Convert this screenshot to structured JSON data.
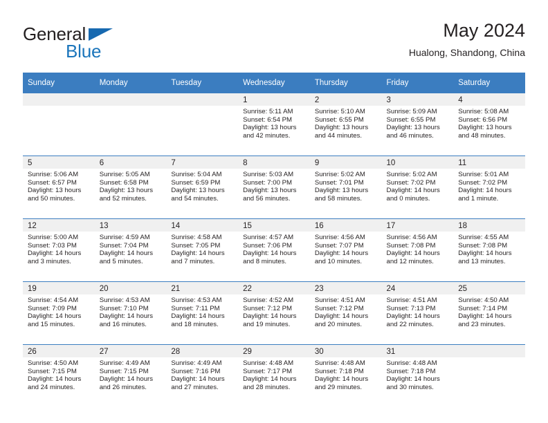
{
  "brand": {
    "name_part1": "General",
    "name_part2": "Blue",
    "triangle_color": "#1769b0",
    "blue_color": "#1b75bb"
  },
  "header": {
    "title": "May 2024",
    "subtitle": "Hualong, Shandong, China"
  },
  "theme": {
    "header_band": "#3b7dc0",
    "day_band": "#f0f0f0",
    "text": "#231f20"
  },
  "weekdays": [
    "Sunday",
    "Monday",
    "Tuesday",
    "Wednesday",
    "Thursday",
    "Friday",
    "Saturday"
  ],
  "weeks": [
    [
      {
        "day": "",
        "empty": true
      },
      {
        "day": "",
        "empty": true
      },
      {
        "day": "",
        "empty": true
      },
      {
        "day": "1",
        "sunrise": "Sunrise: 5:11 AM",
        "sunset": "Sunset: 6:54 PM",
        "daylight1": "Daylight: 13 hours",
        "daylight2": "and 42 minutes."
      },
      {
        "day": "2",
        "sunrise": "Sunrise: 5:10 AM",
        "sunset": "Sunset: 6:55 PM",
        "daylight1": "Daylight: 13 hours",
        "daylight2": "and 44 minutes."
      },
      {
        "day": "3",
        "sunrise": "Sunrise: 5:09 AM",
        "sunset": "Sunset: 6:55 PM",
        "daylight1": "Daylight: 13 hours",
        "daylight2": "and 46 minutes."
      },
      {
        "day": "4",
        "sunrise": "Sunrise: 5:08 AM",
        "sunset": "Sunset: 6:56 PM",
        "daylight1": "Daylight: 13 hours",
        "daylight2": "and 48 minutes."
      }
    ],
    [
      {
        "day": "5",
        "sunrise": "Sunrise: 5:06 AM",
        "sunset": "Sunset: 6:57 PM",
        "daylight1": "Daylight: 13 hours",
        "daylight2": "and 50 minutes."
      },
      {
        "day": "6",
        "sunrise": "Sunrise: 5:05 AM",
        "sunset": "Sunset: 6:58 PM",
        "daylight1": "Daylight: 13 hours",
        "daylight2": "and 52 minutes."
      },
      {
        "day": "7",
        "sunrise": "Sunrise: 5:04 AM",
        "sunset": "Sunset: 6:59 PM",
        "daylight1": "Daylight: 13 hours",
        "daylight2": "and 54 minutes."
      },
      {
        "day": "8",
        "sunrise": "Sunrise: 5:03 AM",
        "sunset": "Sunset: 7:00 PM",
        "daylight1": "Daylight: 13 hours",
        "daylight2": "and 56 minutes."
      },
      {
        "day": "9",
        "sunrise": "Sunrise: 5:02 AM",
        "sunset": "Sunset: 7:01 PM",
        "daylight1": "Daylight: 13 hours",
        "daylight2": "and 58 minutes."
      },
      {
        "day": "10",
        "sunrise": "Sunrise: 5:02 AM",
        "sunset": "Sunset: 7:02 PM",
        "daylight1": "Daylight: 14 hours",
        "daylight2": "and 0 minutes."
      },
      {
        "day": "11",
        "sunrise": "Sunrise: 5:01 AM",
        "sunset": "Sunset: 7:02 PM",
        "daylight1": "Daylight: 14 hours",
        "daylight2": "and 1 minute."
      }
    ],
    [
      {
        "day": "12",
        "sunrise": "Sunrise: 5:00 AM",
        "sunset": "Sunset: 7:03 PM",
        "daylight1": "Daylight: 14 hours",
        "daylight2": "and 3 minutes."
      },
      {
        "day": "13",
        "sunrise": "Sunrise: 4:59 AM",
        "sunset": "Sunset: 7:04 PM",
        "daylight1": "Daylight: 14 hours",
        "daylight2": "and 5 minutes."
      },
      {
        "day": "14",
        "sunrise": "Sunrise: 4:58 AM",
        "sunset": "Sunset: 7:05 PM",
        "daylight1": "Daylight: 14 hours",
        "daylight2": "and 7 minutes."
      },
      {
        "day": "15",
        "sunrise": "Sunrise: 4:57 AM",
        "sunset": "Sunset: 7:06 PM",
        "daylight1": "Daylight: 14 hours",
        "daylight2": "and 8 minutes."
      },
      {
        "day": "16",
        "sunrise": "Sunrise: 4:56 AM",
        "sunset": "Sunset: 7:07 PM",
        "daylight1": "Daylight: 14 hours",
        "daylight2": "and 10 minutes."
      },
      {
        "day": "17",
        "sunrise": "Sunrise: 4:56 AM",
        "sunset": "Sunset: 7:08 PM",
        "daylight1": "Daylight: 14 hours",
        "daylight2": "and 12 minutes."
      },
      {
        "day": "18",
        "sunrise": "Sunrise: 4:55 AM",
        "sunset": "Sunset: 7:08 PM",
        "daylight1": "Daylight: 14 hours",
        "daylight2": "and 13 minutes."
      }
    ],
    [
      {
        "day": "19",
        "sunrise": "Sunrise: 4:54 AM",
        "sunset": "Sunset: 7:09 PM",
        "daylight1": "Daylight: 14 hours",
        "daylight2": "and 15 minutes."
      },
      {
        "day": "20",
        "sunrise": "Sunrise: 4:53 AM",
        "sunset": "Sunset: 7:10 PM",
        "daylight1": "Daylight: 14 hours",
        "daylight2": "and 16 minutes."
      },
      {
        "day": "21",
        "sunrise": "Sunrise: 4:53 AM",
        "sunset": "Sunset: 7:11 PM",
        "daylight1": "Daylight: 14 hours",
        "daylight2": "and 18 minutes."
      },
      {
        "day": "22",
        "sunrise": "Sunrise: 4:52 AM",
        "sunset": "Sunset: 7:12 PM",
        "daylight1": "Daylight: 14 hours",
        "daylight2": "and 19 minutes."
      },
      {
        "day": "23",
        "sunrise": "Sunrise: 4:51 AM",
        "sunset": "Sunset: 7:12 PM",
        "daylight1": "Daylight: 14 hours",
        "daylight2": "and 20 minutes."
      },
      {
        "day": "24",
        "sunrise": "Sunrise: 4:51 AM",
        "sunset": "Sunset: 7:13 PM",
        "daylight1": "Daylight: 14 hours",
        "daylight2": "and 22 minutes."
      },
      {
        "day": "25",
        "sunrise": "Sunrise: 4:50 AM",
        "sunset": "Sunset: 7:14 PM",
        "daylight1": "Daylight: 14 hours",
        "daylight2": "and 23 minutes."
      }
    ],
    [
      {
        "day": "26",
        "sunrise": "Sunrise: 4:50 AM",
        "sunset": "Sunset: 7:15 PM",
        "daylight1": "Daylight: 14 hours",
        "daylight2": "and 24 minutes."
      },
      {
        "day": "27",
        "sunrise": "Sunrise: 4:49 AM",
        "sunset": "Sunset: 7:15 PM",
        "daylight1": "Daylight: 14 hours",
        "daylight2": "and 26 minutes."
      },
      {
        "day": "28",
        "sunrise": "Sunrise: 4:49 AM",
        "sunset": "Sunset: 7:16 PM",
        "daylight1": "Daylight: 14 hours",
        "daylight2": "and 27 minutes."
      },
      {
        "day": "29",
        "sunrise": "Sunrise: 4:48 AM",
        "sunset": "Sunset: 7:17 PM",
        "daylight1": "Daylight: 14 hours",
        "daylight2": "and 28 minutes."
      },
      {
        "day": "30",
        "sunrise": "Sunrise: 4:48 AM",
        "sunset": "Sunset: 7:18 PM",
        "daylight1": "Daylight: 14 hours",
        "daylight2": "and 29 minutes."
      },
      {
        "day": "31",
        "sunrise": "Sunrise: 4:48 AM",
        "sunset": "Sunset: 7:18 PM",
        "daylight1": "Daylight: 14 hours",
        "daylight2": "and 30 minutes."
      },
      {
        "day": "",
        "empty": true
      }
    ]
  ]
}
